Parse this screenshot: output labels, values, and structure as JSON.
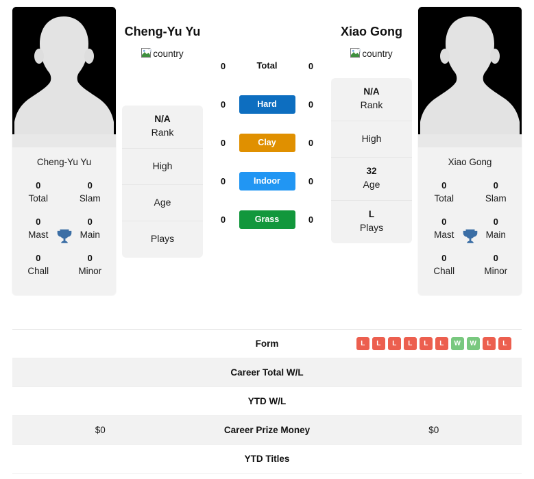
{
  "colors": {
    "hard": "#0d6ec0",
    "clay": "#e09000",
    "indoor": "#2196f3",
    "grass": "#12973c",
    "win": "#79c87f",
    "loss": "#ec5f4f",
    "trophy": "#3b6ea5",
    "card_bg": "#f2f2f2",
    "avatar_bg": "#000000"
  },
  "players": {
    "left": {
      "name": "Cheng-Yu Yu",
      "card_name": "Cheng-Yu Yu",
      "country_alt": "country",
      "stats": [
        {
          "value": "0",
          "label": "Total"
        },
        {
          "value": "0",
          "label": "Slam"
        },
        {
          "value": "0",
          "label": "Mast"
        },
        {
          "value": "0",
          "label": "Main"
        },
        {
          "value": "0",
          "label": "Chall"
        },
        {
          "value": "0",
          "label": "Minor"
        }
      ],
      "info": [
        {
          "value": "N/A",
          "label": "Rank"
        },
        {
          "value": "",
          "label": "High"
        },
        {
          "value": "",
          "label": "Age"
        },
        {
          "value": "",
          "label": "Plays"
        }
      ]
    },
    "right": {
      "name": "Xiao Gong",
      "card_name": "Xiao Gong",
      "country_alt": "country",
      "stats": [
        {
          "value": "0",
          "label": "Total"
        },
        {
          "value": "0",
          "label": "Slam"
        },
        {
          "value": "0",
          "label": "Mast"
        },
        {
          "value": "0",
          "label": "Main"
        },
        {
          "value": "0",
          "label": "Chall"
        },
        {
          "value": "0",
          "label": "Minor"
        }
      ],
      "info": [
        {
          "value": "N/A",
          "label": "Rank"
        },
        {
          "value": "",
          "label": "High"
        },
        {
          "value": "32",
          "label": "Age"
        },
        {
          "value": "L",
          "label": "Plays"
        }
      ]
    }
  },
  "surfaces": [
    {
      "label": "Total",
      "left": "0",
      "right": "0",
      "badge": false,
      "color": ""
    },
    {
      "label": "Hard",
      "left": "0",
      "right": "0",
      "badge": true,
      "color": "#0d6ec0"
    },
    {
      "label": "Clay",
      "left": "0",
      "right": "0",
      "badge": true,
      "color": "#e09000"
    },
    {
      "label": "Indoor",
      "left": "0",
      "right": "0",
      "badge": true,
      "color": "#2196f3"
    },
    {
      "label": "Grass",
      "left": "0",
      "right": "0",
      "badge": true,
      "color": "#12973c"
    }
  ],
  "table": {
    "rows": [
      {
        "label": "Form",
        "left_text": "",
        "right_text": "",
        "striped": false,
        "right_form": [
          "L",
          "L",
          "L",
          "L",
          "L",
          "L",
          "W",
          "W",
          "L",
          "L"
        ],
        "left_form": []
      },
      {
        "label": "Career Total W/L",
        "left_text": "",
        "right_text": "",
        "striped": true,
        "right_form": [],
        "left_form": []
      },
      {
        "label": "YTD W/L",
        "left_text": "",
        "right_text": "",
        "striped": false,
        "right_form": [],
        "left_form": []
      },
      {
        "label": "Career Prize Money",
        "left_text": "$0",
        "right_text": "$0",
        "striped": true,
        "right_form": [],
        "left_form": []
      },
      {
        "label": "YTD Titles",
        "left_text": "",
        "right_text": "",
        "striped": false,
        "right_form": [],
        "left_form": []
      }
    ]
  }
}
